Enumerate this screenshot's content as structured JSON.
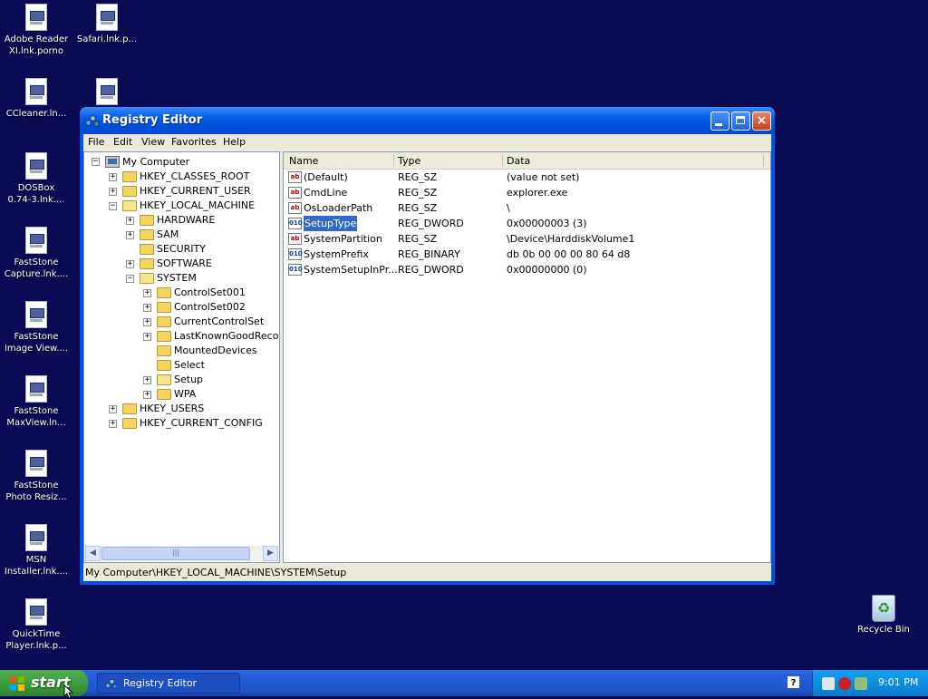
{
  "desktop": {
    "icons": [
      {
        "label": "Adobe Reader\nXI.lnk.porno"
      },
      {
        "label": "Safari.lnk.p..."
      },
      {
        "label": "CCleaner.ln..."
      },
      {
        "label": "DOSBox\n0.74-3.lnk...."
      },
      {
        "label": "FastStone\nCapture.lnk...."
      },
      {
        "label": "FastStone\nImage View...."
      },
      {
        "label": "FastStone\nMaxView.ln..."
      },
      {
        "label": "FastStone\nPhoto Resiz..."
      },
      {
        "label": "MSN\nInstaller.lnk...."
      },
      {
        "label": "QuickTime\nPlayer.lnk.p..."
      }
    ],
    "recycle_bin": "Recycle Bin"
  },
  "window": {
    "title": "Registry Editor",
    "close_glyph": "×",
    "menu": [
      "File",
      "Edit",
      "View",
      "Favorites",
      "Help"
    ],
    "statusbar": "My Computer\\HKEY_LOCAL_MACHINE\\SYSTEM\\Setup"
  },
  "tree": {
    "root": "My Computer",
    "nodes": [
      {
        "label": "HKEY_CLASSES_ROOT",
        "expander": "+"
      },
      {
        "label": "HKEY_CURRENT_USER",
        "expander": "+"
      },
      {
        "label": "HKEY_LOCAL_MACHINE",
        "expander": "−"
      },
      {
        "label": "HARDWARE",
        "expander": "+"
      },
      {
        "label": "SAM",
        "expander": "+"
      },
      {
        "label": "SECURITY",
        "expander": ""
      },
      {
        "label": "SOFTWARE",
        "expander": "+"
      },
      {
        "label": "SYSTEM",
        "expander": "−"
      },
      {
        "label": "ControlSet001",
        "expander": "+"
      },
      {
        "label": "ControlSet002",
        "expander": "+"
      },
      {
        "label": "CurrentControlSet",
        "expander": "+"
      },
      {
        "label": "LastKnownGoodRecove",
        "expander": "+"
      },
      {
        "label": "MountedDevices",
        "expander": ""
      },
      {
        "label": "Select",
        "expander": ""
      },
      {
        "label": "Setup",
        "expander": "+"
      },
      {
        "label": "WPA",
        "expander": "+"
      },
      {
        "label": "HKEY_USERS",
        "expander": "+"
      },
      {
        "label": "HKEY_CURRENT_CONFIG",
        "expander": "+"
      }
    ],
    "scroll_left": "◀",
    "scroll_right": "▶",
    "scroll_grip": "|||"
  },
  "list": {
    "columns": {
      "name": "Name",
      "type": "Type",
      "data": "Data"
    },
    "rows": [
      {
        "name": "(Default)",
        "type": "REG_SZ",
        "data": "(value not set)",
        "icon": "ab"
      },
      {
        "name": "CmdLine",
        "type": "REG_SZ",
        "data": "explorer.exe",
        "icon": "ab"
      },
      {
        "name": "OsLoaderPath",
        "type": "REG_SZ",
        "data": "\\",
        "icon": "ab"
      },
      {
        "name": "SetupType",
        "type": "REG_DWORD",
        "data": "0x00000003 (3)",
        "icon": "010"
      },
      {
        "name": "SystemPartition",
        "type": "REG_SZ",
        "data": "\\Device\\HarddiskVolume1",
        "icon": "ab"
      },
      {
        "name": "SystemPrefix",
        "type": "REG_BINARY",
        "data": "db 0b 00 00 00 80 64 d8",
        "icon": "010"
      },
      {
        "name": "SystemSetupInPr...",
        "type": "REG_DWORD",
        "data": "0x00000000 (0)",
        "icon": "010"
      }
    ],
    "selected": "SetupType"
  },
  "taskbar": {
    "start": "start",
    "task": "Registry Editor",
    "help_glyph": "?",
    "clock": "9:01 PM"
  },
  "colors": {
    "desktop": "#0a0a55",
    "titlebar": "#0a5fe8",
    "selection": "#316ac5",
    "start_green": "#3c9a3c"
  }
}
